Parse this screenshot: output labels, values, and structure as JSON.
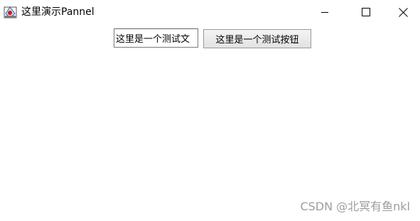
{
  "window": {
    "title": "这里演示Pannel",
    "icon": "java-app-icon",
    "controls": {
      "minimize_icon": "minimize-icon",
      "maximize_icon": "maximize-icon",
      "close_icon": "close-icon"
    }
  },
  "panel": {
    "text_field": {
      "value": "这里是一个测试文"
    },
    "button": {
      "label": "这里是一个测试按钮"
    }
  },
  "watermark": {
    "text": "CSDN @北冥有鱼nkl"
  },
  "colors": {
    "background": "#ffffff",
    "watermark": "#8c8c8c",
    "field_border": "#7a7a7a",
    "button_border": "#9a9a9a"
  }
}
